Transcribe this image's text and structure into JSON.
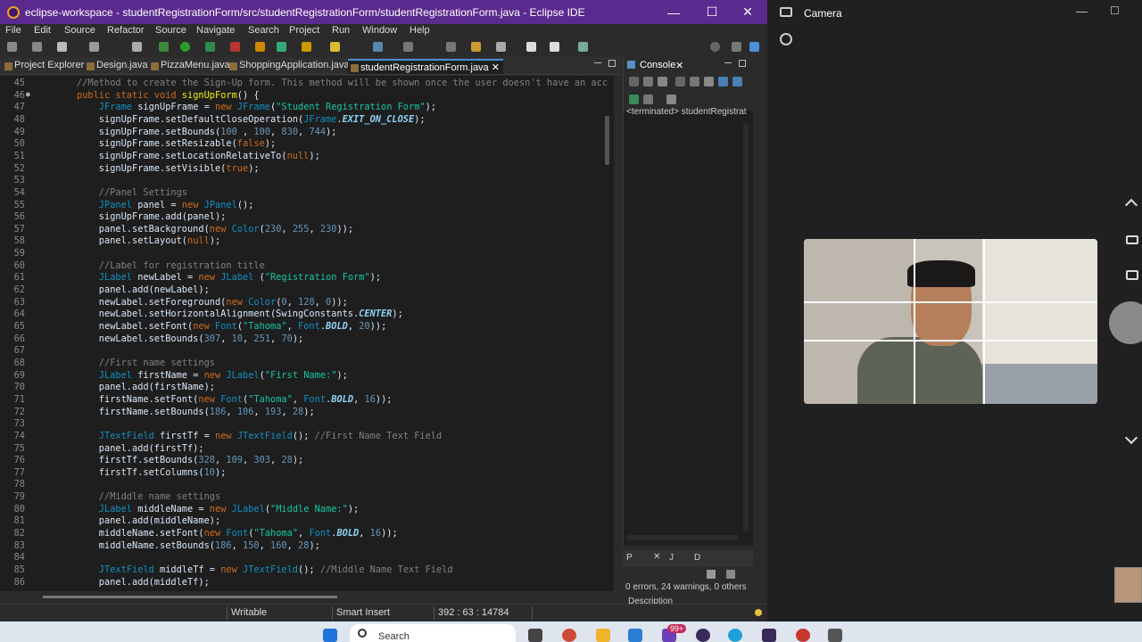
{
  "window": {
    "title": "eclipse-workspace - studentRegistrationForm/src/studentRegistrationForm/studentRegistrationForm.java - Eclipse IDE",
    "min": "—",
    "max": "☐",
    "close": "✕"
  },
  "menu": [
    "File",
    "Edit",
    "Source",
    "Refactor",
    "Source",
    "Navigate",
    "Search",
    "Project",
    "Run",
    "Window",
    "Help"
  ],
  "tabs": [
    {
      "label": "Project Explorer"
    },
    {
      "label": "Design.java"
    },
    {
      "label": "PizzaMenu.java"
    },
    {
      "label": "ShoppingApplication.java"
    },
    {
      "label": "studentRegistrationForm.java",
      "close": "✕"
    }
  ],
  "editor": {
    "lines": [
      {
        "n": "45",
        "c": [
          [
            "cm",
            "//Method to create the Sign-Up form. This method will be shown once the user doesn't have an acc"
          ]
        ]
      },
      {
        "n": "46",
        "marker": "●",
        "c": [
          [
            "kw",
            "public static void "
          ],
          [
            "id",
            "signUpForm"
          ],
          [
            "",
            "() {"
          ]
        ]
      },
      {
        "n": "47",
        "c": [
          [
            "ty",
            "    JFrame "
          ],
          [
            "",
            "signUpFrame = "
          ],
          [
            "kw",
            "new "
          ],
          [
            "ty",
            "JFrame"
          ],
          [
            "",
            "("
          ],
          [
            "str",
            "\"Student Registration Form\""
          ],
          [
            "",
            ");"
          ]
        ]
      },
      {
        "n": "48",
        "c": [
          [
            "",
            "    signUpFrame.setDefaultCloseOperation("
          ],
          [
            "ty",
            "JFrame"
          ],
          [
            "",
            "."
          ],
          [
            "cst",
            "EXIT_ON_CLOSE"
          ],
          [
            "",
            ");"
          ]
        ]
      },
      {
        "n": "49",
        "c": [
          [
            "",
            "    signUpFrame.setBounds("
          ],
          [
            "num",
            "100"
          ],
          [
            "",
            " , "
          ],
          [
            "num",
            "100"
          ],
          [
            "",
            ", "
          ],
          [
            "num",
            "830"
          ],
          [
            "",
            ", "
          ],
          [
            "num",
            "744"
          ],
          [
            "",
            ");"
          ]
        ]
      },
      {
        "n": "50",
        "c": [
          [
            "",
            "    signUpFrame.setResizable("
          ],
          [
            "kw",
            "false"
          ],
          [
            "",
            ");"
          ]
        ]
      },
      {
        "n": "51",
        "c": [
          [
            "",
            "    signUpFrame.setLocationRelativeTo("
          ],
          [
            "kw",
            "null"
          ],
          [
            "",
            ");"
          ]
        ]
      },
      {
        "n": "52",
        "c": [
          [
            "",
            "    signUpFrame.setVisible("
          ],
          [
            "kw",
            "true"
          ],
          [
            "",
            ");"
          ]
        ]
      },
      {
        "n": "53",
        "c": []
      },
      {
        "n": "54",
        "c": [
          [
            "cm",
            "    //Panel Settings"
          ]
        ]
      },
      {
        "n": "55",
        "c": [
          [
            "ty",
            "    JPanel "
          ],
          [
            "",
            "panel = "
          ],
          [
            "kw",
            "new "
          ],
          [
            "ty",
            "JPanel"
          ],
          [
            "",
            "();"
          ]
        ]
      },
      {
        "n": "56",
        "c": [
          [
            "",
            "    signUpFrame.add(panel);"
          ]
        ]
      },
      {
        "n": "57",
        "c": [
          [
            "",
            "    panel.setBackground("
          ],
          [
            "kw",
            "new "
          ],
          [
            "ty",
            "Color"
          ],
          [
            "",
            "("
          ],
          [
            "num",
            "230"
          ],
          [
            "",
            ", "
          ],
          [
            "num",
            "255"
          ],
          [
            "",
            ", "
          ],
          [
            "num",
            "230"
          ],
          [
            "",
            "));"
          ]
        ]
      },
      {
        "n": "58",
        "c": [
          [
            "",
            "    panel.setLayout("
          ],
          [
            "kw",
            "null"
          ],
          [
            "",
            ");"
          ]
        ]
      },
      {
        "n": "59",
        "c": []
      },
      {
        "n": "60",
        "c": [
          [
            "cm",
            "    //Label for registration title"
          ]
        ]
      },
      {
        "n": "61",
        "c": [
          [
            "ty",
            "    JLabel "
          ],
          [
            "",
            "newLabel = "
          ],
          [
            "kw",
            "new "
          ],
          [
            "ty",
            "JLabel "
          ],
          [
            "",
            "("
          ],
          [
            "str",
            "\"Registration Form\""
          ],
          [
            "",
            ");"
          ]
        ]
      },
      {
        "n": "62",
        "c": [
          [
            "",
            "    panel.add(newLabel);"
          ]
        ]
      },
      {
        "n": "63",
        "c": [
          [
            "",
            "    newLabel.setForeground("
          ],
          [
            "kw",
            "new "
          ],
          [
            "ty",
            "Color"
          ],
          [
            "",
            "("
          ],
          [
            "num",
            "0"
          ],
          [
            "",
            ", "
          ],
          [
            "num",
            "128"
          ],
          [
            "",
            ", "
          ],
          [
            "num",
            "0"
          ],
          [
            "",
            "));"
          ]
        ]
      },
      {
        "n": "64",
        "c": [
          [
            "",
            "    newLabel.setHorizontalAlignment(SwingConstants."
          ],
          [
            "cst",
            "CENTER"
          ],
          [
            "",
            ");"
          ]
        ]
      },
      {
        "n": "65",
        "c": [
          [
            "",
            "    newLabel.setFont("
          ],
          [
            "kw",
            "new "
          ],
          [
            "ty",
            "Font"
          ],
          [
            "",
            "("
          ],
          [
            "str",
            "\"Tahoma\""
          ],
          [
            "",
            ", "
          ],
          [
            "ty",
            "Font"
          ],
          [
            "",
            "."
          ],
          [
            "cst",
            "BOLD"
          ],
          [
            "",
            ", "
          ],
          [
            "num",
            "20"
          ],
          [
            "",
            "));"
          ]
        ]
      },
      {
        "n": "66",
        "c": [
          [
            "",
            "    newLabel.setBounds("
          ],
          [
            "num",
            "307"
          ],
          [
            "",
            ", "
          ],
          [
            "num",
            "10"
          ],
          [
            "",
            ", "
          ],
          [
            "num",
            "251"
          ],
          [
            "",
            ", "
          ],
          [
            "num",
            "70"
          ],
          [
            "",
            ");"
          ]
        ]
      },
      {
        "n": "67",
        "c": []
      },
      {
        "n": "68",
        "c": [
          [
            "cm",
            "    //First name settings"
          ]
        ]
      },
      {
        "n": "69",
        "c": [
          [
            "ty",
            "    JLabel "
          ],
          [
            "",
            "firstName = "
          ],
          [
            "kw",
            "new "
          ],
          [
            "ty",
            "JLabel"
          ],
          [
            "",
            "("
          ],
          [
            "str",
            "\"First Name:\""
          ],
          [
            "",
            ");"
          ]
        ]
      },
      {
        "n": "70",
        "c": [
          [
            "",
            "    panel.add(firstName);"
          ]
        ]
      },
      {
        "n": "71",
        "c": [
          [
            "",
            "    firstName.setFont("
          ],
          [
            "kw",
            "new "
          ],
          [
            "ty",
            "Font"
          ],
          [
            "",
            "("
          ],
          [
            "str",
            "\"Tahoma\""
          ],
          [
            "",
            ", "
          ],
          [
            "ty",
            "Font"
          ],
          [
            "",
            "."
          ],
          [
            "cst",
            "BOLD"
          ],
          [
            "",
            ", "
          ],
          [
            "num",
            "16"
          ],
          [
            "",
            "));"
          ]
        ]
      },
      {
        "n": "72",
        "c": [
          [
            "",
            "    firstName.setBounds("
          ],
          [
            "num",
            "186"
          ],
          [
            "",
            ", "
          ],
          [
            "num",
            "106"
          ],
          [
            "",
            ", "
          ],
          [
            "num",
            "193"
          ],
          [
            "",
            ", "
          ],
          [
            "num",
            "28"
          ],
          [
            "",
            ");"
          ]
        ]
      },
      {
        "n": "73",
        "c": []
      },
      {
        "n": "74",
        "c": [
          [
            "ty",
            "    JTextField "
          ],
          [
            "",
            "firstTf = "
          ],
          [
            "kw",
            "new "
          ],
          [
            "ty",
            "JTextField"
          ],
          [
            "",
            "(); "
          ],
          [
            "cm",
            "//First Name Text Field"
          ]
        ]
      },
      {
        "n": "75",
        "c": [
          [
            "",
            "    panel.add(firstTf);"
          ]
        ]
      },
      {
        "n": "76",
        "c": [
          [
            "",
            "    firstTf.setBounds("
          ],
          [
            "num",
            "328"
          ],
          [
            "",
            ", "
          ],
          [
            "num",
            "109"
          ],
          [
            "",
            ", "
          ],
          [
            "num",
            "303"
          ],
          [
            "",
            ", "
          ],
          [
            "num",
            "28"
          ],
          [
            "",
            ");"
          ]
        ]
      },
      {
        "n": "77",
        "c": [
          [
            "",
            "    firstTf.setColumns("
          ],
          [
            "num",
            "10"
          ],
          [
            "",
            ");"
          ]
        ]
      },
      {
        "n": "78",
        "c": []
      },
      {
        "n": "79",
        "c": [
          [
            "cm",
            "    //Middle name settings"
          ]
        ]
      },
      {
        "n": "80",
        "c": [
          [
            "ty",
            "    JLabel "
          ],
          [
            "",
            "middleName = "
          ],
          [
            "kw",
            "new "
          ],
          [
            "ty",
            "JLabel"
          ],
          [
            "",
            "("
          ],
          [
            "str",
            "\"Middle Name:\""
          ],
          [
            "",
            ");"
          ]
        ]
      },
      {
        "n": "81",
        "c": [
          [
            "",
            "    panel.add(middleName);"
          ]
        ]
      },
      {
        "n": "82",
        "c": [
          [
            "",
            "    middleName.setFont("
          ],
          [
            "kw",
            "new "
          ],
          [
            "ty",
            "Font"
          ],
          [
            "",
            "("
          ],
          [
            "str",
            "\"Tahoma\""
          ],
          [
            "",
            ", "
          ],
          [
            "ty",
            "Font"
          ],
          [
            "",
            "."
          ],
          [
            "cst",
            "BOLD"
          ],
          [
            "",
            ", "
          ],
          [
            "num",
            "16"
          ],
          [
            "",
            "));"
          ]
        ]
      },
      {
        "n": "83",
        "c": [
          [
            "",
            "    middleName.setBounds("
          ],
          [
            "num",
            "186"
          ],
          [
            "",
            ", "
          ],
          [
            "num",
            "150"
          ],
          [
            "",
            ", "
          ],
          [
            "num",
            "160"
          ],
          [
            "",
            ", "
          ],
          [
            "num",
            "28"
          ],
          [
            "",
            ");"
          ]
        ]
      },
      {
        "n": "84",
        "c": []
      },
      {
        "n": "85",
        "c": [
          [
            "ty",
            "    JTextField "
          ],
          [
            "",
            "middleTf = "
          ],
          [
            "kw",
            "new "
          ],
          [
            "ty",
            "JTextField"
          ],
          [
            "",
            "(); "
          ],
          [
            "cm",
            "//Middle Name Text Field"
          ]
        ]
      },
      {
        "n": "86",
        "c": [
          [
            "",
            "    panel.add(middleTf);"
          ]
        ]
      }
    ]
  },
  "console": {
    "title": "Console",
    "close": "✕",
    "terminated": "<terminated> studentRegistrat"
  },
  "problems": {
    "tabs": [
      "P",
      "J",
      "D"
    ],
    "summary": "0 errors, 24 warnings, 0 others",
    "column": "Description"
  },
  "status": {
    "writable": "Writable",
    "insert_mode": "Smart Insert",
    "position": "392 : 63 : 14784"
  },
  "camera_app": {
    "title": "Camera",
    "min": "—",
    "max": "☐"
  },
  "taskbar": {
    "search_placeholder": "Search",
    "badge": "99+"
  },
  "colors": {
    "titlebar": "#5b2a8e",
    "keyword": "#cc6c1d",
    "string": "#17c6a3",
    "comment": "#808080",
    "type": "#1290c3"
  }
}
